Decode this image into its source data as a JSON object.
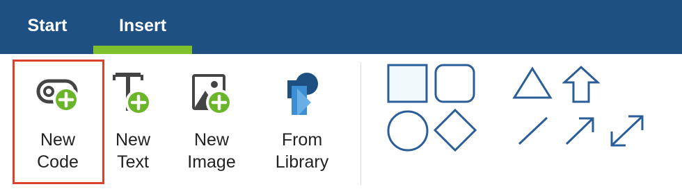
{
  "tabs": [
    {
      "label": "Start",
      "active": false
    },
    {
      "label": "Insert",
      "active": true
    }
  ],
  "ribbon": {
    "tools": [
      {
        "label_line1": "New",
        "label_line2": "Code",
        "icon": "code-add-icon",
        "selected": true
      },
      {
        "label_line1": "New",
        "label_line2": "Text",
        "icon": "text-add-icon",
        "selected": false
      },
      {
        "label_line1": "New",
        "label_line2": "Image",
        "icon": "image-add-icon",
        "selected": false
      },
      {
        "label_line1": "From",
        "label_line2": "Library",
        "icon": "library-icon",
        "selected": false
      }
    ],
    "shapes": [
      "square",
      "rounded-square",
      "circle",
      "diamond",
      "triangle",
      "up-arrow",
      "line",
      "arrow",
      "double-arrow"
    ]
  },
  "colors": {
    "tabbar": "#1f5082",
    "tab_underline": "#7ec12d",
    "shape_stroke": "#2b5e98",
    "shape_fill": "#f2f9fd",
    "plus_badge": "#6bb52a",
    "selection_border": "#d9432c"
  }
}
